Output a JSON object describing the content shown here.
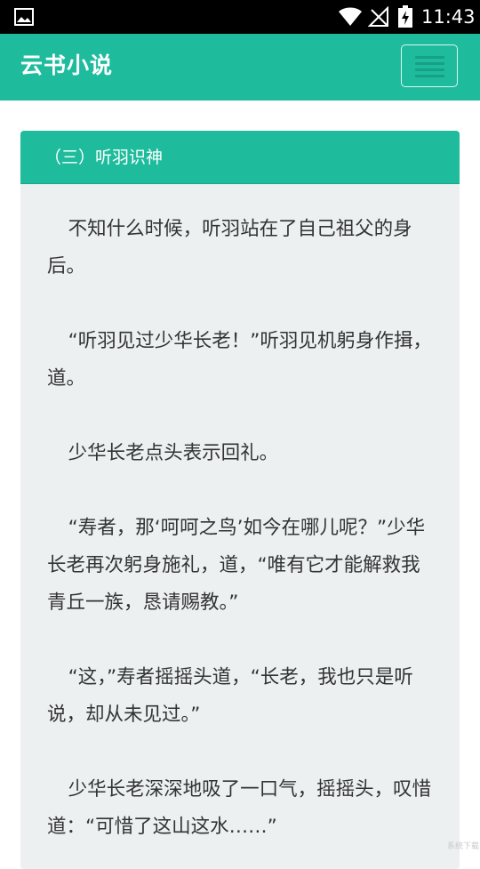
{
  "status_bar": {
    "time": "11:43",
    "icons": [
      "image-icon",
      "wifi-icon",
      "signal-off-icon",
      "battery-charging-icon"
    ]
  },
  "app_bar": {
    "title": "云书小说",
    "menu_icon": "hamburger-menu-icon"
  },
  "chapter": {
    "title": "（三）听羽识神",
    "paragraphs": [
      "不知什么时候，听羽站在了自己祖父的身后。",
      "“听羽见过少华长老！”听羽见机躬身作揖，道。",
      "少华长老点头表示回礼。",
      "“寿者，那‘呵呵之鸟’如今在哪儿呢？”少华长老再次躬身施礼，道，“唯有它才能解救我青丘一族，恳请赐教。”",
      "“这，”寿者摇摇头道，“长老，我也只是听说，却从未见过。”",
      "少华长老深深地吸了一口气，摇摇头，叹惜道：“可惜了这山这水……”"
    ]
  },
  "watermark": "系统下载",
  "colors": {
    "primary": "#1ebc9c",
    "card_bg": "#ecf0f1",
    "text": "#333333",
    "status_bar": "#000000"
  }
}
